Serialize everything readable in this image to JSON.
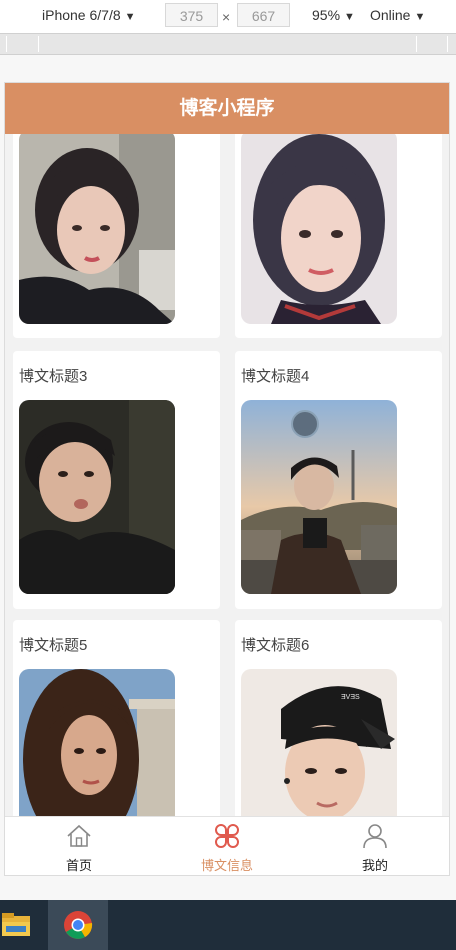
{
  "devtools": {
    "device": "iPhone 6/7/8",
    "width": "375",
    "height": "667",
    "times": "×",
    "zoom": "95%",
    "network": "Online",
    "caret": "▼"
  },
  "app": {
    "title": "博客小程序",
    "accent_color": "#d98f63"
  },
  "posts": [
    {
      "title": "",
      "photo": "girl-short-hair-portrait"
    },
    {
      "title": "",
      "photo": "girl-bob-hair-portrait"
    },
    {
      "title": "博文标题3",
      "photo": "boy-dark-shirt-portrait"
    },
    {
      "title": "博文标题4",
      "photo": "boy-city-sunset-portrait"
    },
    {
      "title": "博文标题5",
      "photo": "girl-long-hair-portrait"
    },
    {
      "title": "博文标题6",
      "photo": "boy-black-cap-portrait"
    }
  ],
  "tabbar": {
    "tabs": [
      {
        "label": "首页",
        "icon": "home-icon",
        "active": false
      },
      {
        "label": "博文信息",
        "icon": "grid-icon",
        "active": true
      },
      {
        "label": "我的",
        "icon": "user-icon",
        "active": false
      }
    ]
  },
  "taskbar": {
    "apps": [
      "file-explorer-icon",
      "chrome-icon"
    ]
  }
}
